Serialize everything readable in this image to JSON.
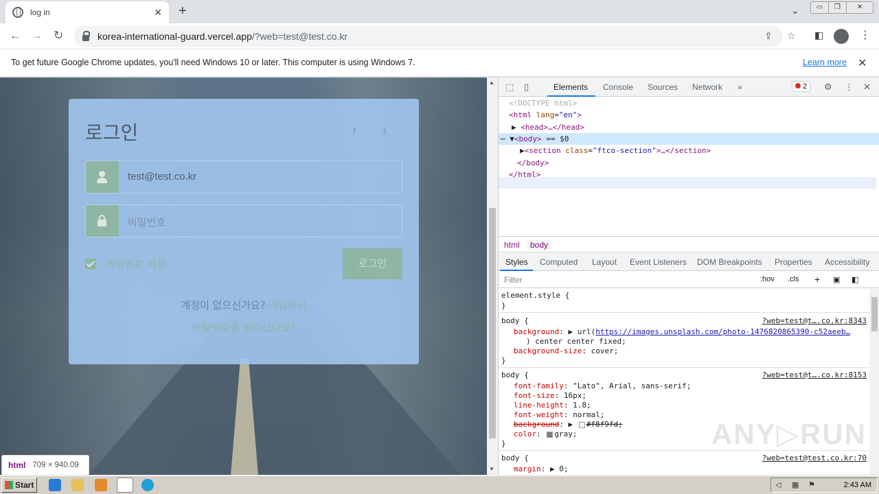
{
  "browser": {
    "tab_title": "log in",
    "tab_close": "✕",
    "new_tab": "+",
    "tab_search": "⌄",
    "window_buttons": [
      "▭",
      "❐",
      "✕"
    ],
    "url_host": "korea-international-guard.vercel.app",
    "url_rest": "/?web=test@test.co.kr",
    "nav": {
      "back": "←",
      "forward": "→",
      "reload": "↻"
    }
  },
  "infobar": {
    "message": "To get future Google Chrome updates, you'll need Windows 10 or later. This computer is using Windows 7.",
    "learn_more": "Learn more",
    "close": "✕"
  },
  "login": {
    "heading": "로그인",
    "facebook": "f",
    "twitter": "t",
    "email_value": "test@test.co.kr",
    "password_placeholder": "비밀번호",
    "remember_label": "비밀번호 저장",
    "login_button": "로그인",
    "no_account": "계정이 없으신가요?",
    "signup": "가입하기",
    "forgot": "비밀번호를 잊으셨나요?"
  },
  "inspect_tooltip": {
    "tag": "html",
    "dims": "709 × 940.09"
  },
  "devtools": {
    "tabs": [
      "Elements",
      "Console",
      "Sources",
      "Network"
    ],
    "more_tabs": "»",
    "error_count": "2",
    "dom": {
      "doctype": "<!DOCTYPE html>",
      "html_open_tag": "<html",
      "html_attr": "lang",
      "html_attr_val": "\"en\"",
      "html_open_end": ">",
      "head": "<head>…</head>",
      "body_open": "<body>",
      "body_marker": "== $0",
      "section_tag": "<section",
      "section_attr": "class",
      "section_attr_val": "\"ftco-section\"",
      "section_end": ">…</section>",
      "body_close": "</body>",
      "html_close": "</html>"
    },
    "breadcrumbs": [
      "html",
      "body"
    ],
    "pane_tabs": [
      "Styles",
      "Computed",
      "Layout",
      "Event Listeners",
      "DOM Breakpoints",
      "Properties",
      "Accessibility"
    ],
    "filter_placeholder": "Filter",
    "filter_tools": {
      "hov": ":hov",
      "cls": ".cls",
      "add": "+"
    },
    "styles": {
      "element_style": "element.style {",
      "close_brace": "}",
      "rule1": {
        "selector": "body {",
        "source": "?web=test@t….co.kr:8343",
        "prop1": "background",
        "val1_prefix": "url(",
        "val1_link": "https://images.unsplash.com/photo-1476820865390-c52aeeb…",
        "val1_suffix": ") center center fixed;",
        "prop2": "background-size",
        "val2": "cover;"
      },
      "rule2": {
        "selector": "body {",
        "source": "?web=test@t….co.kr:8153",
        "props": [
          {
            "name": "font-family",
            "value": "\"Lato\", Arial, sans-serif;"
          },
          {
            "name": "font-size",
            "value": "16px;"
          },
          {
            "name": "line-height",
            "value": "1.8;"
          },
          {
            "name": "font-weight",
            "value": "normal;"
          },
          {
            "name": "background",
            "value": "#f8f9fd;"
          },
          {
            "name": "color",
            "value": "gray;"
          }
        ]
      },
      "rule3": {
        "selector": "body {",
        "source": "?web=test@test.co.kr:70",
        "prop": "margin",
        "value": "0;"
      }
    },
    "watermark": "ANY▷RUN"
  },
  "taskbar": {
    "start": "Start",
    "clock": "2:43 AM"
  },
  "colors": {
    "accent": "#1a73e8",
    "card": "#a0c3eb",
    "green": "#8fb5a5"
  }
}
